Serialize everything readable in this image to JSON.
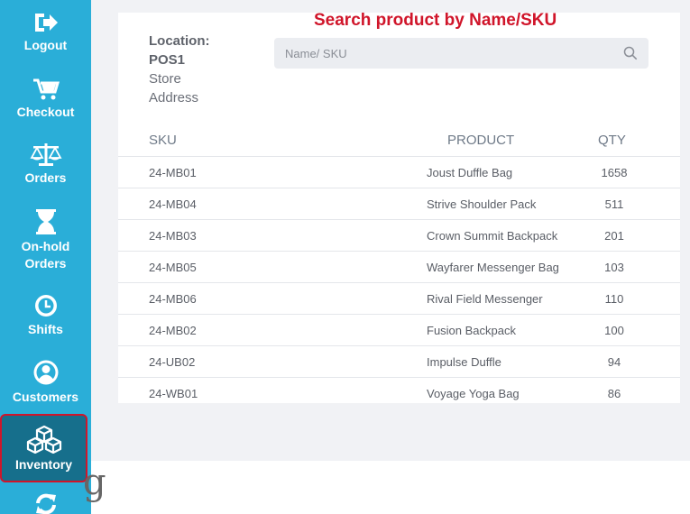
{
  "sidebar": {
    "items": [
      {
        "label": "Logout",
        "icon": "logout-icon"
      },
      {
        "label": "Checkout",
        "icon": "cart-icon"
      },
      {
        "label": "Orders",
        "icon": "scale-icon"
      },
      {
        "label_line1": "On-hold",
        "label_line2": "Orders",
        "icon": "hourglass-icon"
      },
      {
        "label": "Shifts",
        "icon": "clock-icon"
      },
      {
        "label": "Customers",
        "icon": "user-icon"
      },
      {
        "label": "Inventory",
        "icon": "boxes-icon",
        "active": true
      },
      {
        "label": "",
        "icon": "sync-icon"
      }
    ]
  },
  "annotation": "Search product by Name/SKU",
  "location": {
    "label": "Location:",
    "name": "POS1",
    "line1": "Store",
    "line2": "Address"
  },
  "search": {
    "placeholder": "Name/ SKU",
    "value": ""
  },
  "table": {
    "headers": {
      "sku": "SKU",
      "product": "PRODUCT",
      "qty": "QTY"
    },
    "rows": [
      {
        "sku": "24-MB01",
        "product": "Joust Duffle Bag",
        "qty": "1658"
      },
      {
        "sku": "24-MB04",
        "product": "Strive Shoulder Pack",
        "qty": "511"
      },
      {
        "sku": "24-MB03",
        "product": "Crown Summit Backpack",
        "qty": "201"
      },
      {
        "sku": "24-MB05",
        "product": "Wayfarer Messenger Bag",
        "qty": "103"
      },
      {
        "sku": "24-MB06",
        "product": "Rival Field Messenger",
        "qty": "110"
      },
      {
        "sku": "24-MB02",
        "product": "Fusion Backpack",
        "qty": "100"
      },
      {
        "sku": "24-UB02",
        "product": "Impulse Duffle",
        "qty": "94"
      },
      {
        "sku": "24-WB01",
        "product": "Voyage Yoga Bag",
        "qty": "86"
      }
    ]
  },
  "colors": {
    "sidebar": "#2aaed8",
    "sidebar_active": "#166f8c",
    "highlight": "#d0152a",
    "content_bg": "#f1f2f5"
  },
  "fragment_glyph": "g"
}
